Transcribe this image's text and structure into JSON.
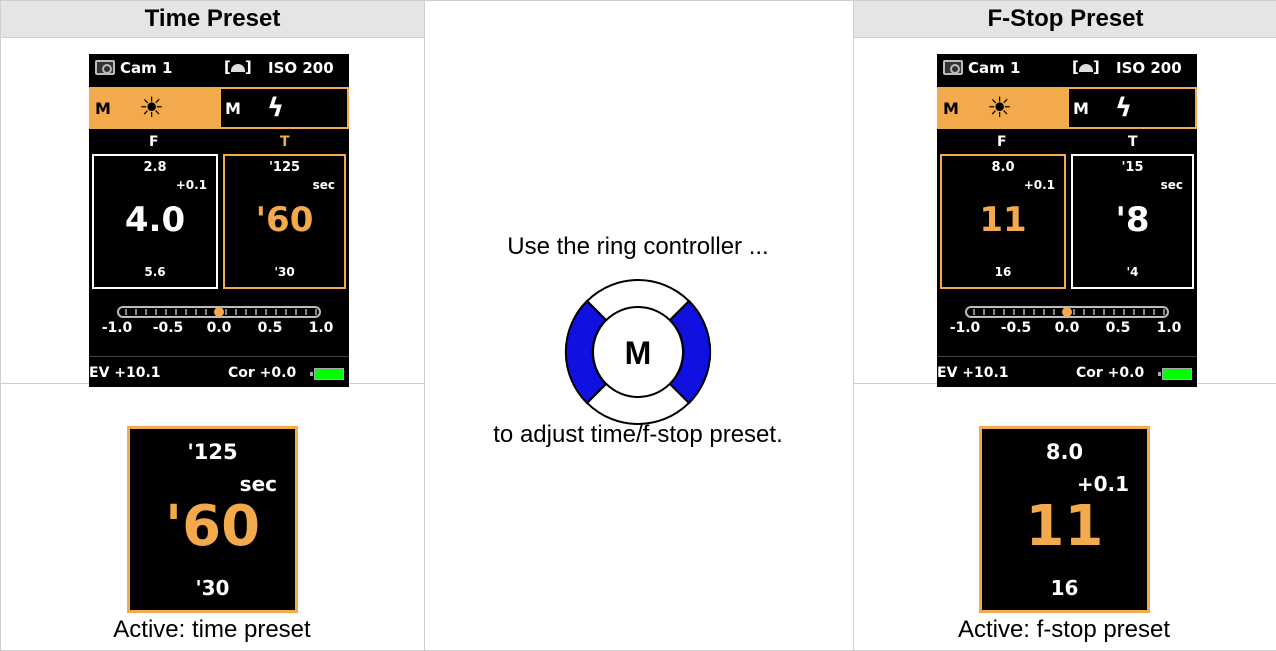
{
  "left": {
    "header": "Time Preset",
    "screen": {
      "cam": "Cam 1",
      "meter_glyph": "[",
      "meter_glyph_close": "]",
      "iso": "ISO 200",
      "mode_left": "M",
      "mode_right": "M",
      "icon_left": "sun-icon",
      "icon_right": "flash-icon",
      "label_f": "F",
      "label_t": "T",
      "f_box": {
        "top": "2.8",
        "small": "+0.1",
        "big": "4.0",
        "bottom": "5.6"
      },
      "t_box": {
        "top": "'125",
        "small": "sec",
        "big": "'60",
        "bottom": "'30"
      },
      "active": "t",
      "scale": [
        "-1.0",
        "-0.5",
        "0.0",
        "0.5",
        "1.0"
      ],
      "ev": "EV  +10.1",
      "cor": "Cor +0.0"
    },
    "zoom": {
      "top": "'125",
      "small": "sec",
      "big": "'60",
      "bottom": "'30"
    },
    "caption": "Active: time preset"
  },
  "middle": {
    "line1": "Use the ring controller ...",
    "ring_label": "M",
    "line2": "to adjust time/f-stop preset."
  },
  "right": {
    "header": "F-Stop Preset",
    "screen": {
      "cam": "Cam 1",
      "meter_glyph": "[",
      "meter_glyph_close": "]",
      "iso": "ISO 200",
      "mode_left": "M",
      "mode_right": "M",
      "icon_left": "sun-icon",
      "icon_right": "flash-icon",
      "label_f": "F",
      "label_t": "T",
      "f_box": {
        "top": "8.0",
        "small": "+0.1",
        "big": "11",
        "bottom": "16"
      },
      "t_box": {
        "top": "'15",
        "small": "sec",
        "big": "'8",
        "bottom": "'4"
      },
      "active": "f",
      "scale": [
        "-1.0",
        "-0.5",
        "0.0",
        "0.5",
        "1.0"
      ],
      "ev": "EV  +10.1",
      "cor": "Cor +0.0"
    },
    "zoom": {
      "top": "8.0",
      "small": "+0.1",
      "big": "11",
      "bottom": "16"
    },
    "caption": "Active: f-stop preset"
  },
  "colors": {
    "accent": "#f2aa4c",
    "ring_blue": "#1010e0",
    "battery": "#00ff00"
  }
}
